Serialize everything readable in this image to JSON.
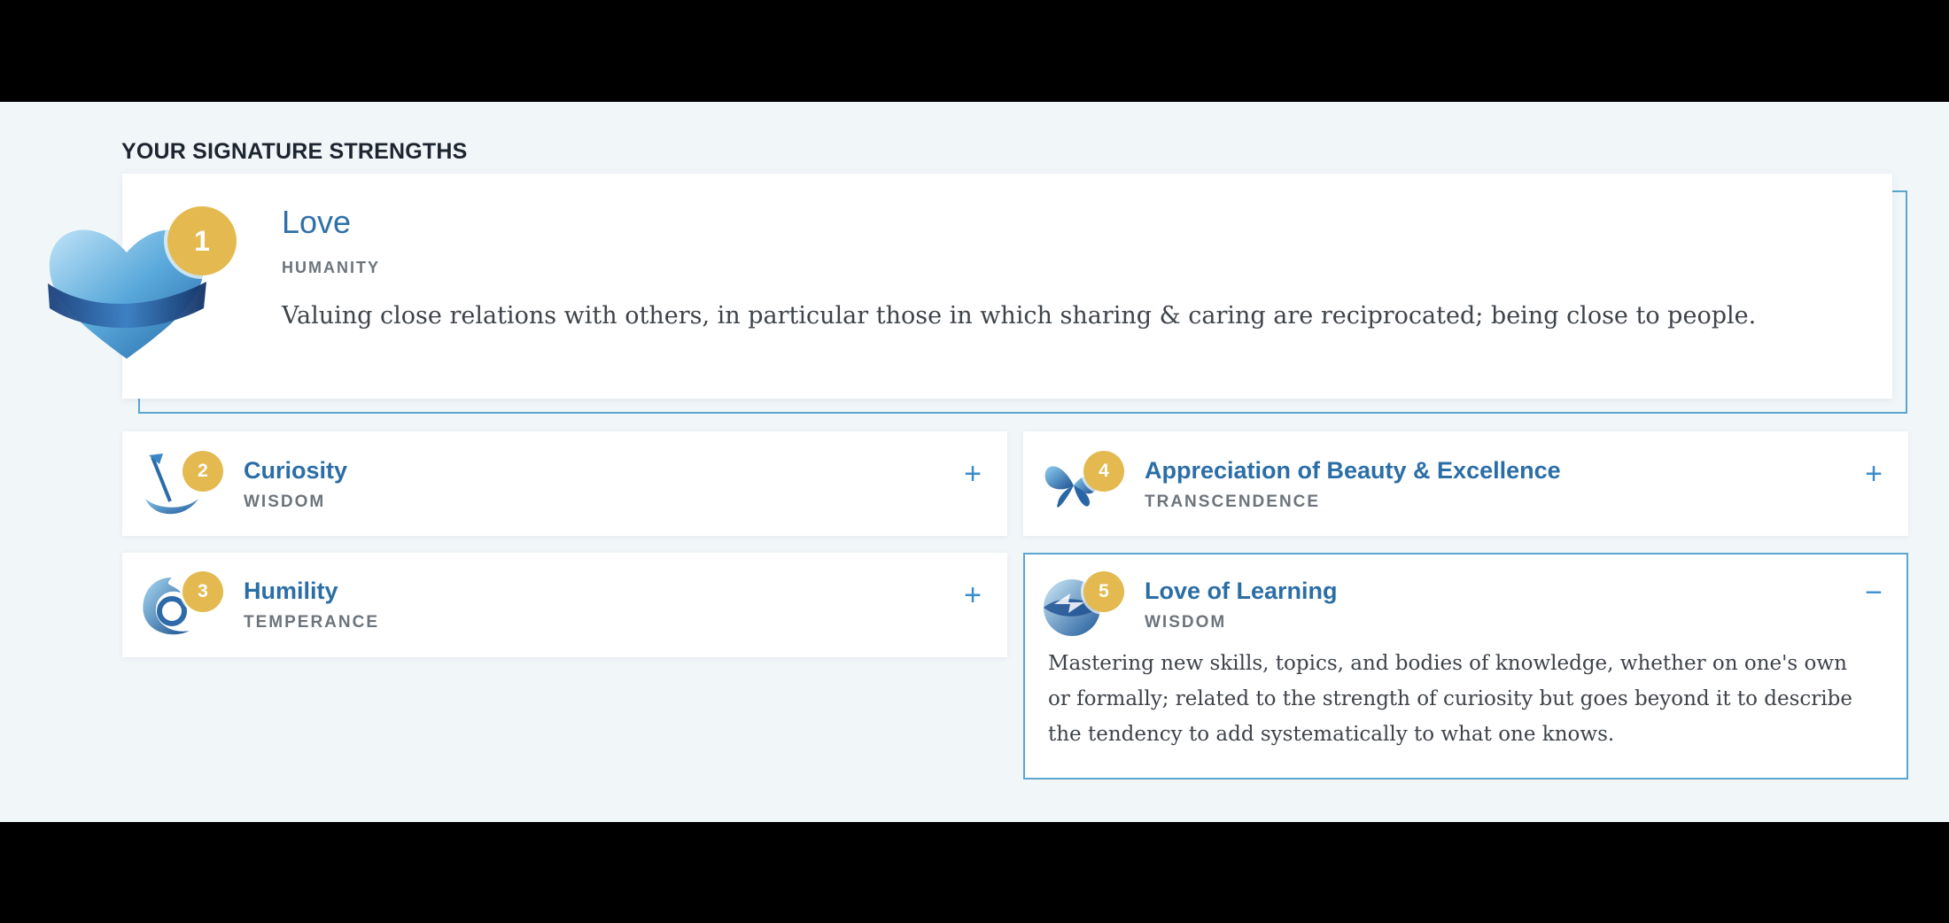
{
  "section_title": "YOUR SIGNATURE STRENGTHS",
  "featured": {
    "rank": "1",
    "title": "Love",
    "category": "HUMANITY",
    "description": "Valuing close relations with others, in particular those in which sharing & caring are reciprocated; being close to people.",
    "icon": "heart-icon"
  },
  "strengths": [
    {
      "rank": "2",
      "title": "Curiosity",
      "category": "WISDOM",
      "toggle": "+",
      "icon": "compass-flag-icon"
    },
    {
      "rank": "3",
      "title": "Humility",
      "category": "TEMPERANCE",
      "toggle": "+",
      "icon": "swirl-icon"
    },
    {
      "rank": "4",
      "title": "Appreciation of Beauty & Excellence",
      "category": "TRANSCENDENCE",
      "toggle": "+",
      "icon": "butterfly-icon"
    },
    {
      "rank": "5",
      "title": "Love of Learning",
      "category": "WISDOM",
      "toggle": "−",
      "icon": "globe-icon",
      "description": "Mastering new skills, topics, and bodies of knowledge, whether on one's own or formally; related to the strength of curiosity but goes beyond it to describe the tendency to add systematically to what one knows."
    }
  ],
  "colors": {
    "accent": "#3070a8",
    "badge": "#e4b94f",
    "outline": "#5aa6cf",
    "background": "#f1f6f9"
  }
}
